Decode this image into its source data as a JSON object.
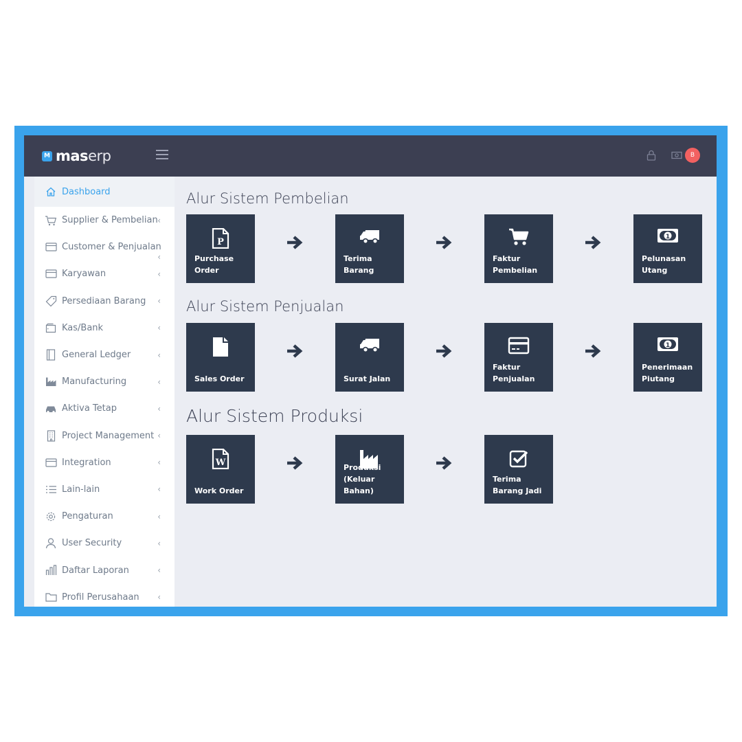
{
  "topbar": {
    "logo_badge": "M",
    "logo_bold": "mas",
    "logo_light": "erp",
    "notification_count": "B"
  },
  "sidebar": {
    "items": [
      {
        "label": "Dashboard",
        "icon": "home-icon"
      },
      {
        "label": "Supplier & Pembelian",
        "icon": "cart-icon"
      },
      {
        "label": "Customer & Penjualan",
        "icon": "card-icon"
      },
      {
        "label": "Karyawan",
        "icon": "card-icon"
      },
      {
        "label": "Persediaan Barang",
        "icon": "tag-icon"
      },
      {
        "label": "Kas/Bank",
        "icon": "wallet-icon"
      },
      {
        "label": "General Ledger",
        "icon": "book-icon"
      },
      {
        "label": "Manufacturing",
        "icon": "factory-icon"
      },
      {
        "label": "Aktiva Tetap",
        "icon": "car-icon"
      },
      {
        "label": "Project Management",
        "icon": "building-icon"
      },
      {
        "label": "Integration",
        "icon": "card-icon"
      },
      {
        "label": "Lain-lain",
        "icon": "list-icon"
      },
      {
        "label": "Pengaturan",
        "icon": "gear-icon"
      },
      {
        "label": "User Security",
        "icon": "user-icon"
      },
      {
        "label": "Daftar Laporan",
        "icon": "bar-chart-icon"
      },
      {
        "label": "Profil Perusahaan",
        "icon": "folder-icon"
      }
    ]
  },
  "sections": [
    {
      "title": "Alur Sistem Pembelian",
      "tiles": [
        {
          "label": "Purchase\nOrder",
          "icon": "document-p-icon"
        },
        {
          "label": "Terima\nBarang",
          "icon": "truck-icon"
        },
        {
          "label": "Faktur\nPembelian",
          "icon": "cart-icon"
        },
        {
          "label": "Pelunasan\nUtang",
          "icon": "money-icon"
        }
      ]
    },
    {
      "title": "Alur Sistem Penjualan",
      "tiles": [
        {
          "label": "Sales Order",
          "icon": "file-icon"
        },
        {
          "label": "Surat Jalan",
          "icon": "truck-icon"
        },
        {
          "label": "Faktur\nPenjualan",
          "icon": "credit-card-icon"
        },
        {
          "label": "Penerimaan\nPiutang",
          "icon": "money-icon"
        }
      ]
    },
    {
      "title": "Alur Sistem Produksi",
      "tiles": [
        {
          "label": "Work Order",
          "icon": "document-w-icon"
        },
        {
          "label": "Produksi\n(Keluar\nBahan)",
          "icon": "factory-icon"
        },
        {
          "label": "Terima\nBarang Jadi",
          "icon": "check-square-icon"
        }
      ]
    }
  ],
  "colors": {
    "frame": "#3aa3ec",
    "topbar": "#3c3f52",
    "tile": "#2e3a4d",
    "accent": "#3aa3ec",
    "badge": "#f26161"
  }
}
